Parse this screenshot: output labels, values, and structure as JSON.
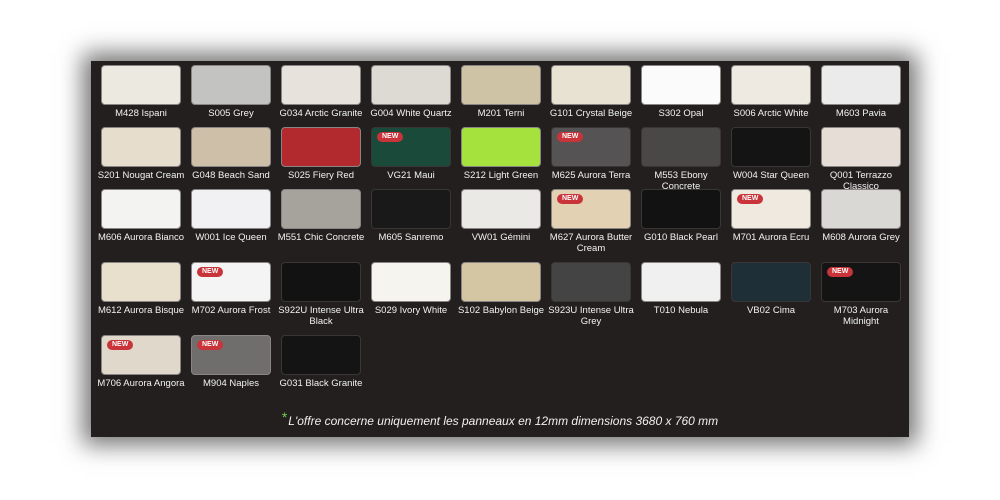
{
  "footnote": {
    "marker": "*",
    "text": "L'offre concerne uniquement les panneaux en 12mm dimensions 3680 x 760 mm"
  },
  "badge_text": "NEW",
  "swatches": [
    {
      "code": "M428 Ispani",
      "color": "#ece9e1",
      "new": false
    },
    {
      "code": "S005 Grey",
      "color": "#c3c4c2",
      "new": false
    },
    {
      "code": "G034 Arctic Granite",
      "color": "#e7e3dc",
      "new": false
    },
    {
      "code": "G004 White Quartz",
      "color": "#dcdad3",
      "new": false
    },
    {
      "code": "M201 Terni",
      "color": "#cfc3a6",
      "new": false
    },
    {
      "code": "G101 Crystal Beige",
      "color": "#e8e2d2",
      "new": false
    },
    {
      "code": "S302 Opal",
      "color": "#fbfbfb",
      "new": false
    },
    {
      "code": "S006 Arctic White",
      "color": "#eeeae2",
      "new": false
    },
    {
      "code": "M603 Pavia",
      "color": "#ebebeb",
      "new": false
    },
    {
      "code": "S201 Nougat Cream",
      "color": "#e6ddcd",
      "new": false
    },
    {
      "code": "G048 Beach Sand",
      "color": "#cdbfa8",
      "new": false
    },
    {
      "code": "S025 Fiery Red",
      "color": "#b22a2d",
      "new": false
    },
    {
      "code": "VG21 Maui",
      "color": "#1a4a3a",
      "new": true
    },
    {
      "code": "S212 Light Green",
      "color": "#a6e23e",
      "new": false
    },
    {
      "code": "M625 Aurora Terra",
      "color": "#555353",
      "new": true
    },
    {
      "code": "M553 Ebony Concrete",
      "color": "#4a4846",
      "new": false
    },
    {
      "code": "W004 Star Queen",
      "color": "#141414",
      "new": false
    },
    {
      "code": "Q001 Terrazzo Classico",
      "color": "#e5ddd6",
      "new": false
    },
    {
      "code": "M606 Aurora Bianco",
      "color": "#f3f3f1",
      "new": false
    },
    {
      "code": "W001 Ice Queen",
      "color": "#f1f1f4",
      "new": false
    },
    {
      "code": "M551 Chic Concrete",
      "color": "#a6a39d",
      "new": false
    },
    {
      "code": "M605 Sanremo",
      "color": "#191919",
      "new": false
    },
    {
      "code": "VW01 Gémini",
      "color": "#ebe9e5",
      "new": false
    },
    {
      "code": "M627 Aurora Butter Cream",
      "color": "#e2d2b3",
      "new": true
    },
    {
      "code": "G010 Black Pearl",
      "color": "#121212",
      "new": false
    },
    {
      "code": "M701 Aurora Ecru",
      "color": "#efe9e0",
      "new": true
    },
    {
      "code": "M608 Aurora Grey",
      "color": "#d9d8d4",
      "new": false
    },
    {
      "code": "M612 Aurora Bisque",
      "color": "#e9dfcd",
      "new": false
    },
    {
      "code": "M702 Aurora Frost",
      "color": "#f4f4f4",
      "new": true
    },
    {
      "code": "S922U Intense Ultra Black",
      "color": "#121212",
      "new": false
    },
    {
      "code": "S029 Ivory White",
      "color": "#f6f4ef",
      "new": false
    },
    {
      "code": "S102 Babylon Beige",
      "color": "#d5c6a3",
      "new": false
    },
    {
      "code": "S923U Intense Ultra Grey",
      "color": "#444444",
      "new": false
    },
    {
      "code": "T010 Nebula",
      "color": "#f0f0f0",
      "new": false
    },
    {
      "code": "VB02 Cima",
      "color": "#1f2f38",
      "new": false
    },
    {
      "code": "M703 Aurora Midnight",
      "color": "#141414",
      "new": true
    },
    {
      "code": "M706 Aurora Angora",
      "color": "#e1d8cc",
      "new": true
    },
    {
      "code": "M904 Naples",
      "color": "#6f6e6c",
      "new": true
    },
    {
      "code": "G031 Black Granite",
      "color": "#141414",
      "new": false
    }
  ]
}
